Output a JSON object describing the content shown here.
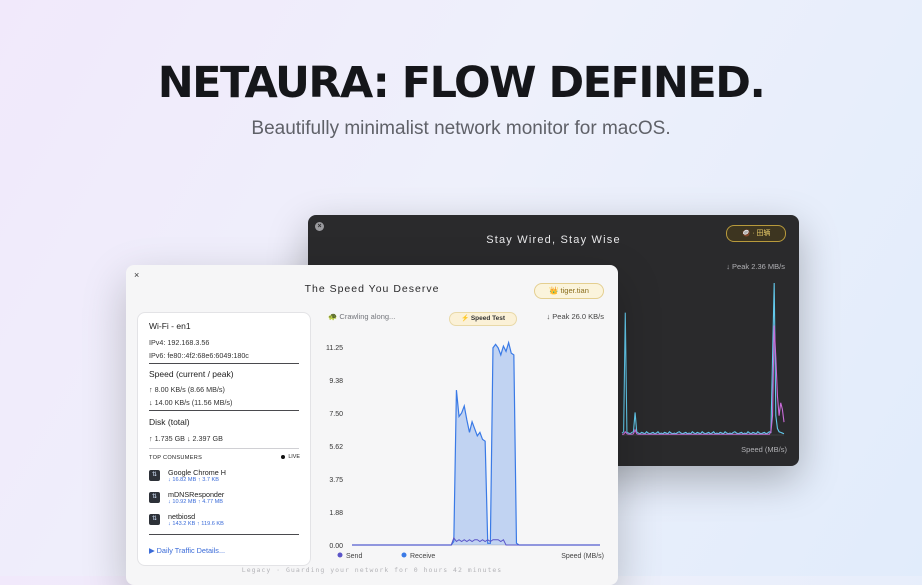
{
  "hero": {
    "title": "NETAURA: FLOW DEFINED.",
    "subtitle": "Beautifully minimalist network monitor for macOS."
  },
  "dark_window": {
    "close_glyph": "×",
    "title": "Stay Wired, Stay Wise",
    "badge": "🥥 · 田辆",
    "peak": "↓ Peak  2.36 MB/s",
    "axis_label": "Speed (MB/s)"
  },
  "light_window": {
    "close_glyph": "×",
    "title": "The Speed You Deserve",
    "badge": "👑  tiger.tian",
    "panel": {
      "network": "Wi-Fi - en1",
      "ipv4": "IPv4: 192.168.3.56",
      "ipv6": "IPv6: fe80::4f2:68e6:6049:180c",
      "speed_heading": "Speed (current / peak)",
      "upload": "↑ 8.00 KB/s (8.66 MB/s)",
      "download": "↓ 14.00 KB/s (11.56 MB/s)",
      "disk_heading": "Disk (total)",
      "disk_values": "↑ 1.735 GB   ↓ 2.397 GB",
      "top_consumers_label": "TOP CONSUMERS",
      "live_label": "LIVE",
      "consumers": [
        {
          "name": "Google Chrome H",
          "stats": "↓ 16.82 MB  ↑ 3.7 KB"
        },
        {
          "name": "mDNSResponder",
          "stats": "↓ 10.92 MB  ↑ 4.77 MB"
        },
        {
          "name": "netbiosd",
          "stats": "↓ 143.2 KB  ↑ 119.6 KB"
        }
      ],
      "details_link": "▶  Daily Traffic Details..."
    },
    "status": "🐢  Crawling along...",
    "speed_test_button": "⚡ Speed Test",
    "peak": "↓ Peak  26.0 KB/s",
    "footer": "Legacy · Guarding your network for 0 hours 42 minutes"
  },
  "colors": {
    "send": "#5b55c8",
    "receive": "#3a7ae6",
    "dark_cyan": "#62c9ec",
    "dark_magenta": "#c86ad8",
    "badge_gold": "#b89a3c"
  },
  "chart_data": {
    "type": "line",
    "x_points": 96,
    "ylim": [
      0,
      11.25
    ],
    "y_ticks": [
      "11.25",
      "9.38",
      "7.50",
      "5.62",
      "3.75",
      "1.88",
      "0.00"
    ],
    "xlabel": "",
    "ylabel": "Speed (MB/s)",
    "series": [
      {
        "name": "Send",
        "values": [
          0,
          0,
          0,
          0,
          0,
          0,
          0,
          0,
          0,
          0,
          0,
          0,
          0,
          0,
          0,
          0,
          0,
          0,
          0,
          0,
          0,
          0,
          0,
          0,
          0,
          0,
          0,
          0,
          0,
          0,
          0,
          0,
          0,
          0,
          0,
          0,
          0,
          0,
          0,
          0.4,
          0.2,
          0.3,
          0.2,
          0.3,
          0.2,
          0.3,
          0.2,
          0.3,
          0.3,
          0.2,
          0.3,
          0.2,
          0.3,
          0.2,
          0.3,
          0.3,
          0.3,
          0.2,
          0.3,
          0,
          0,
          0,
          0,
          0,
          0,
          0,
          0,
          0,
          0,
          0,
          0,
          0,
          0,
          0,
          0,
          0,
          0,
          0,
          0,
          0,
          0,
          0,
          0,
          0,
          0,
          0,
          0,
          0,
          0,
          0,
          0,
          0,
          0,
          0,
          0,
          0
        ]
      },
      {
        "name": "Receive",
        "values": [
          0,
          0,
          0,
          0,
          0,
          0,
          0,
          0,
          0,
          0,
          0,
          0,
          0,
          0,
          0,
          0,
          0,
          0,
          0,
          0,
          0,
          0,
          0,
          0,
          0,
          0,
          0,
          0,
          0,
          0,
          0,
          0,
          0,
          0,
          0,
          0,
          0,
          0,
          0,
          0.2,
          8.8,
          7.3,
          7.5,
          7.9,
          7.1,
          6.4,
          7.0,
          6.6,
          6.2,
          6.4,
          6.0,
          5.9,
          0.1,
          0.1,
          11.2,
          11.4,
          11.2,
          10.8,
          11.3,
          11.0,
          11.5,
          10.9,
          10.8,
          0.1,
          0,
          0,
          0,
          0,
          0,
          0,
          0,
          0,
          0,
          0,
          0,
          0,
          0,
          0,
          0,
          0,
          0,
          0,
          0,
          0,
          0,
          0,
          0,
          0,
          0,
          0,
          0,
          0,
          0,
          0,
          0,
          0
        ]
      }
    ]
  },
  "dark_chart_data": {
    "type": "line",
    "x_points": 100,
    "ylim": [
      0,
      2.36
    ],
    "xlabel": "",
    "ylabel": "Speed (MB/s)",
    "series": [
      {
        "name": "",
        "values": [
          0.03,
          0.05,
          1.9,
          0.04,
          0.03,
          0.02,
          0.04,
          0.05,
          0.35,
          0.05,
          0.03,
          0.02,
          0.04,
          0.03,
          0.02,
          0.05,
          0.03,
          0.02,
          0.03,
          0.04,
          0.02,
          0.03,
          0.05,
          0.02,
          0.03,
          0.02,
          0.04,
          0.03,
          0.02,
          0.05,
          0.03,
          0.02,
          0.03,
          0.02,
          0.04,
          0.05,
          0.03,
          0.02,
          0.03,
          0.04,
          0.02,
          0.03,
          0.02,
          0.05,
          0.03,
          0.02,
          0.04,
          0.03,
          0.02,
          0.05,
          0.03,
          0.02,
          0.03,
          0.04,
          0.02,
          0.03,
          0.05,
          0.02,
          0.03,
          0.02,
          0.04,
          0.03,
          0.02,
          0.05,
          0.03,
          0.02,
          0.03,
          0.02,
          0.04,
          0.05,
          0.03,
          0.02,
          0.03,
          0.04,
          0.02,
          0.03,
          0.02,
          0.05,
          0.03,
          0.02,
          0.04,
          0.03,
          0.02,
          0.05,
          0.03,
          0.02,
          0.03,
          0.04,
          0.02,
          0.03,
          0.05,
          0.04,
          1.2,
          2.36,
          0.3,
          0.1,
          0.05,
          0.04,
          0.03,
          0.02
        ]
      },
      {
        "name": "",
        "values": [
          0.01,
          0.01,
          0.05,
          0.02,
          0.01,
          0.01,
          0.01,
          0.02,
          0.08,
          0.02,
          0.01,
          0.01,
          0.01,
          0.01,
          0.01,
          0.01,
          0.01,
          0.01,
          0.01,
          0.01,
          0.01,
          0.01,
          0.01,
          0.01,
          0.01,
          0.01,
          0.01,
          0.01,
          0.01,
          0.01,
          0.01,
          0.01,
          0.01,
          0.01,
          0.01,
          0.01,
          0.01,
          0.01,
          0.01,
          0.01,
          0.01,
          0.01,
          0.01,
          0.01,
          0.01,
          0.01,
          0.01,
          0.01,
          0.01,
          0.01,
          0.01,
          0.01,
          0.01,
          0.01,
          0.01,
          0.01,
          0.01,
          0.01,
          0.01,
          0.01,
          0.01,
          0.01,
          0.01,
          0.01,
          0.01,
          0.01,
          0.01,
          0.01,
          0.01,
          0.01,
          0.01,
          0.01,
          0.01,
          0.01,
          0.01,
          0.01,
          0.01,
          0.01,
          0.01,
          0.01,
          0.01,
          0.01,
          0.01,
          0.01,
          0.01,
          0.01,
          0.01,
          0.01,
          0.01,
          0.01,
          0.01,
          0.05,
          0.3,
          1.7,
          1.2,
          0.6,
          0.3,
          0.5,
          0.4,
          0.2
        ]
      }
    ]
  }
}
